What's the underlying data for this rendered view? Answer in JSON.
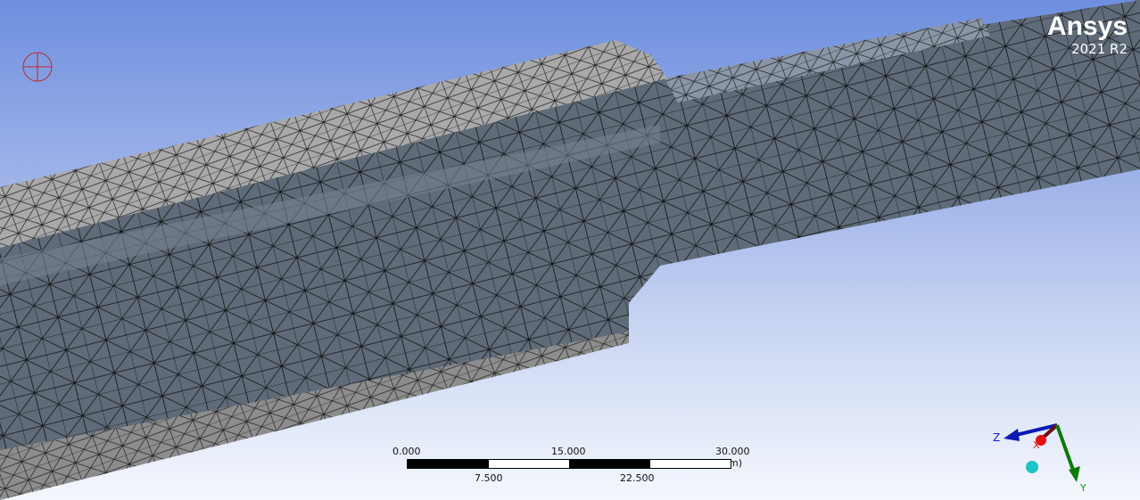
{
  "logo": {
    "brand": "Ansys",
    "version": "2021 R2"
  },
  "scale_bar": {
    "labels_top": [
      "0.000",
      "15.000",
      "30.000 (mm)"
    ],
    "labels_bottom": [
      "7.500",
      "22.500"
    ]
  },
  "triad": {
    "x": "X",
    "y": "Y",
    "z": "Z"
  },
  "colors": {
    "mesh_body": "#5f6b79",
    "mesh_light": "#a7a7a7",
    "mesh_line": "#111111"
  }
}
